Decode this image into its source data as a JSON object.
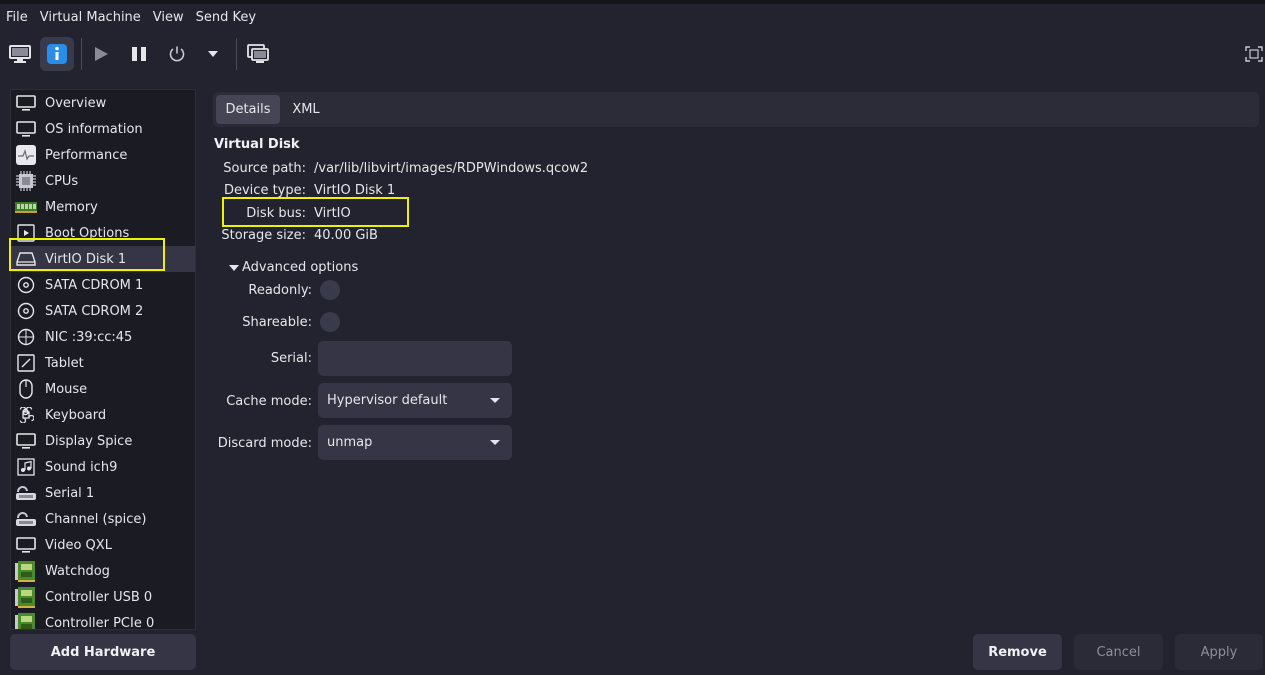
{
  "menu": [
    "File",
    "Virtual Machine",
    "View",
    "Send Key"
  ],
  "toolbar": {
    "icons": [
      "monitor-icon",
      "info-icon",
      "play-icon",
      "pause-icon",
      "power-icon",
      "chevron-down-icon",
      "screenshot-icon",
      "fullscreen-icon"
    ]
  },
  "sidebar": {
    "items": [
      {
        "label": "Overview",
        "icon": "monitor-icon"
      },
      {
        "label": "OS information",
        "icon": "monitor-icon"
      },
      {
        "label": "Performance",
        "icon": "performance-icon"
      },
      {
        "label": "CPUs",
        "icon": "cpu-icon"
      },
      {
        "label": "Memory",
        "icon": "memory-icon"
      },
      {
        "label": "Boot Options",
        "icon": "boot-icon"
      },
      {
        "label": "VirtIO Disk 1",
        "icon": "disk-icon"
      },
      {
        "label": "SATA CDROM 1",
        "icon": "cdrom-icon"
      },
      {
        "label": "SATA CDROM 2",
        "icon": "cdrom-icon"
      },
      {
        "label": "NIC :39:cc:45",
        "icon": "nic-icon"
      },
      {
        "label": "Tablet",
        "icon": "tablet-icon"
      },
      {
        "label": "Mouse",
        "icon": "mouse-icon"
      },
      {
        "label": "Keyboard",
        "icon": "keyboard-icon"
      },
      {
        "label": "Display Spice",
        "icon": "monitor-icon"
      },
      {
        "label": "Sound ich9",
        "icon": "sound-icon"
      },
      {
        "label": "Serial 1",
        "icon": "serial-icon"
      },
      {
        "label": "Channel (spice)",
        "icon": "serial-icon"
      },
      {
        "label": "Video QXL",
        "icon": "monitor-icon"
      },
      {
        "label": "Watchdog",
        "icon": "card-icon"
      },
      {
        "label": "Controller USB 0",
        "icon": "card-icon"
      },
      {
        "label": "Controller PCIe 0",
        "icon": "card-icon"
      }
    ],
    "selected": "VirtIO Disk 1",
    "add_hardware": "Add Hardware"
  },
  "tabs": [
    "Details",
    "XML"
  ],
  "details": {
    "section_title": "Virtual Disk",
    "source_path_label": "Source path:",
    "source_path": "/var/lib/libvirt/images/RDPWindows.qcow2",
    "device_type_label": "Device type:",
    "device_type": "VirtIO Disk 1",
    "disk_bus_label": "Disk bus:",
    "disk_bus": "VirtIO",
    "storage_size_label": "Storage size:",
    "storage_size": "40.00 GiB",
    "advanced_label": "Advanced options",
    "readonly_label": "Readonly:",
    "shareable_label": "Shareable:",
    "serial_label": "Serial:",
    "serial_value": "",
    "cache_mode_label": "Cache mode:",
    "cache_mode": "Hypervisor default",
    "discard_mode_label": "Discard mode:",
    "discard_mode": "unmap"
  },
  "buttons": {
    "remove": "Remove",
    "cancel": "Cancel",
    "apply": "Apply"
  },
  "colors": {
    "background": "#23232f",
    "sidebar": "#1b1b24",
    "highlight": "#f0f000",
    "info_accent": "#2a8de8"
  }
}
